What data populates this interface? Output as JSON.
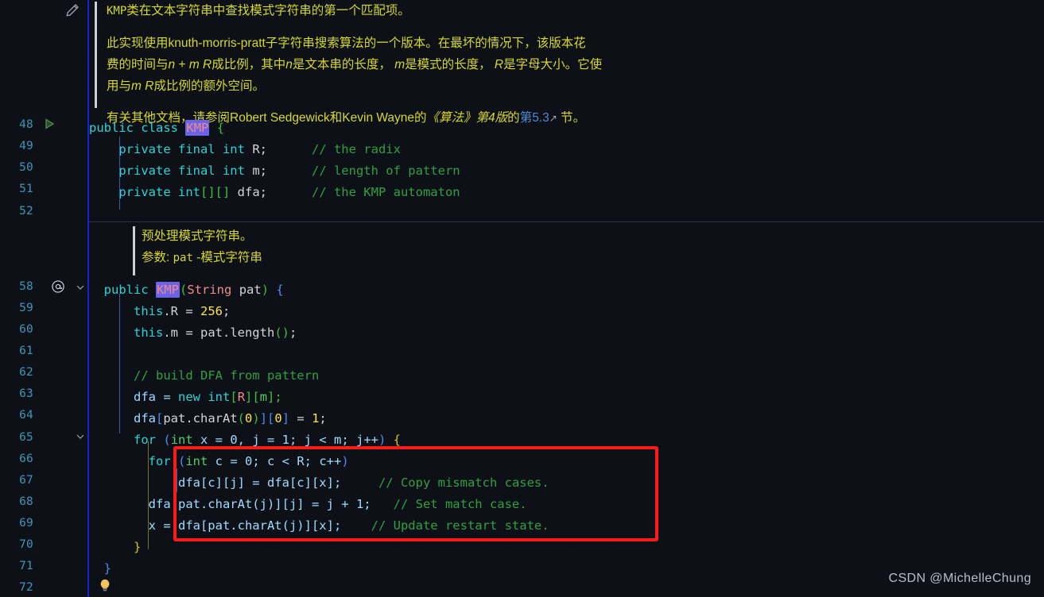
{
  "app": {
    "kind": "code-editor",
    "language": "java",
    "theme_background": "#0d1117",
    "gutter_rule_color": "#1822d6",
    "annotation_box_color": "#ff1a1a",
    "selection_color": "#6b63e8"
  },
  "watermark": "CSDN @MichelleChung",
  "gutter": {
    "icons": {
      "pencil": "pencil-icon",
      "run": "run-play-icon",
      "annotation": "at-sign-icon",
      "fold": "chevron-down-icon",
      "lightbulb": "lightbulb-icon"
    },
    "line_numbers": [
      "48",
      "49",
      "50",
      "51",
      "52",
      "58",
      "59",
      "60",
      "61",
      "62",
      "63",
      "64",
      "65",
      "66",
      "67",
      "68",
      "69",
      "70",
      "71",
      "72"
    ]
  },
  "doc_class": {
    "paragraphs": [
      "KMP类在文本字符串中查找模式字符串的第一个匹配项。",
      "此实现使用knuth-morris-pratt子字符串搜索算法的一个版本。在最坏的情况下，该版本花",
      "费的时间与n + m R成比例，其中n是文本串的长度， m是模式的长度， R是字母大小。它使",
      "用与m R成比例的额外空间。",
      "有关其他文档，请参阅Robert Sedgewick和Kevin Wayne的《算法》第4版的第5.3 ↗ 节。"
    ],
    "line1_head": "KMP",
    "line1_rest": "类在文本字符串中查找模式字符串的第一个匹配项。",
    "line2": "此实现使用knuth-morris-pratt子字符串搜索算法的一个版本。在最坏的情况下，该版本花",
    "line3_a": "费的时间与",
    "line3_n": "n",
    "line3_b": " + ",
    "line3_m": "m R",
    "line3_c": "成比例，其中",
    "line3_n2": "n",
    "line3_d": "是文本串的长度，",
    "line3_m2": " m",
    "line3_e": "是模式的长度，",
    "line3_r": " R",
    "line3_f": "是字母大小。它使",
    "line4_a": "用与",
    "line4_m": "m R",
    "line4_b": "成比例的额外空间。",
    "line5_a": "有关其他文档，请参阅Robert Sedgewick和Kevin Wayne的",
    "line5_book": "《算法》第4版",
    "line5_b": "的",
    "line5_link": "第5.3",
    "line5_arrow": "↗",
    "line5_c": " 节。"
  },
  "doc_ctor": {
    "line1": "预处理模式字符串。",
    "line2_label": "参数:",
    "line2_param": "pat",
    "line2_desc": " -模式字符串"
  },
  "code": {
    "l48": {
      "num": "48",
      "kw1": "public",
      "kw2": "class",
      "name": "KMP",
      "brace": "{"
    },
    "l49": {
      "num": "49",
      "kw": "private final int",
      "var": "R;",
      "cmt": "// the radix"
    },
    "l50": {
      "num": "50",
      "kw": "private final int",
      "var": "m;",
      "cmt": "// length of pattern"
    },
    "l51": {
      "num": "51",
      "kw": "private int",
      "br": "[][]",
      "var": "dfa;",
      "cmt": "// the KMP automaton"
    },
    "l52": {
      "num": "52",
      "text": ""
    },
    "l58": {
      "num": "58",
      "kw": "public",
      "name": "KMP",
      "p1": "(",
      "type": "String",
      "arg": "pat",
      "p2": ")",
      "brace": "{"
    },
    "l59": {
      "num": "59",
      "kw": "this",
      "dot": ".R = ",
      "num_val": "256",
      "semi": ";"
    },
    "l60": {
      "num": "60",
      "kw": "this",
      "dot": ".m = pat.length",
      "p": "()",
      "semi": ";"
    },
    "l61": {
      "num": "61",
      "text": ""
    },
    "l62": {
      "num": "62",
      "cmt": "// build DFA from pattern"
    },
    "l63": {
      "num": "63",
      "a": "dfa = ",
      "kw": "new",
      "t": "int",
      "b1": "[",
      "v1": "R",
      "b2": "][",
      "v2": "m",
      "b3": "];"
    },
    "l64": {
      "num": "64",
      "a": "dfa",
      "b1": "[",
      "inner": "pat.charAt",
      "p1": "(",
      "z": "0",
      "p2": ")",
      "b2": "][",
      "z2": "0",
      "b3": "]",
      "eq": " = ",
      "one": "1",
      "semi": ";"
    },
    "l65": {
      "num": "65",
      "kw": "for",
      "p1": "(",
      "t": "int",
      "body": " x = 0, j = 1; j < m; j++",
      "p2": ")",
      "brace": "{"
    },
    "l66": {
      "num": "66",
      "kw": "for",
      "p1": "(",
      "t": "int",
      "body": " c = 0; c < R; c++",
      "p2": ")"
    },
    "l67": {
      "num": "67",
      "code": "dfa[c][j] = dfa[c][x];",
      "cmt": "// Copy mismatch cases."
    },
    "l68": {
      "num": "68",
      "code": "dfa[pat.charAt(j)][j] = j + 1;",
      "cmt": "// Set match case."
    },
    "l69": {
      "num": "69",
      "code": "x = dfa[pat.charAt(j)][x];",
      "cmt": "// Update restart state."
    },
    "l70": {
      "num": "70",
      "brace": "}"
    },
    "l71": {
      "num": "71",
      "brace": "}"
    },
    "l72": {
      "num": "72",
      "text": ""
    }
  },
  "annotation": {
    "box_label": "red-highlight-box",
    "covers_lines": [
      "66",
      "67",
      "68",
      "69"
    ]
  }
}
